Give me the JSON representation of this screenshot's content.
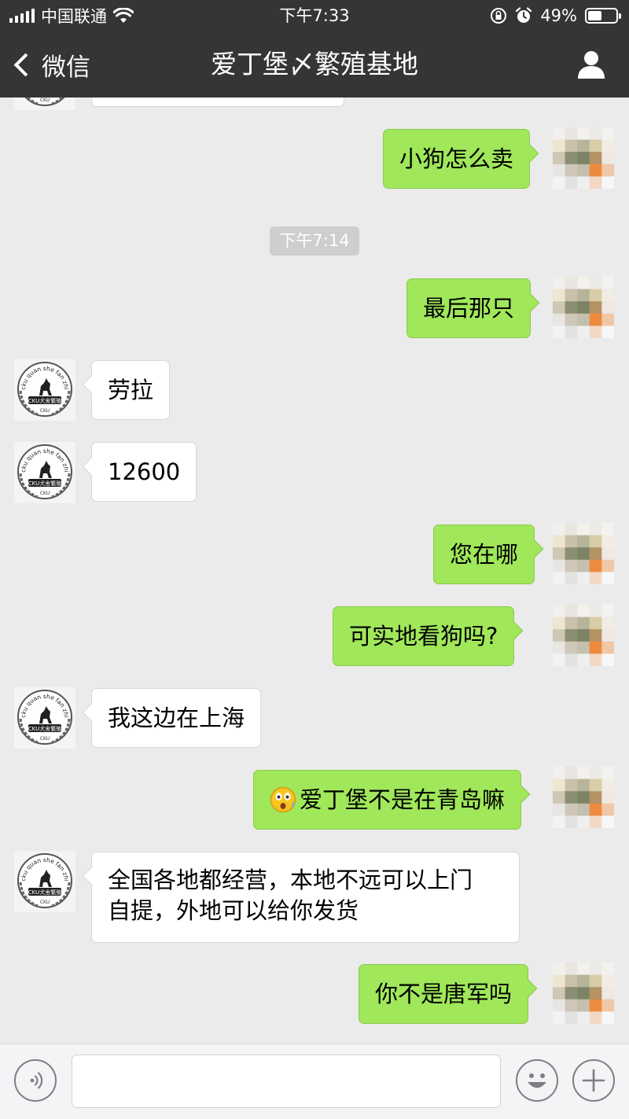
{
  "status_bar": {
    "carrier": "中国联通",
    "time": "下午7:33",
    "battery": "49%",
    "battery_level": 0.49
  },
  "nav": {
    "back_label": "微信",
    "title": "爱丁堡〆繁殖基地"
  },
  "chat": {
    "messages": [
      {
        "side": "in",
        "text": ""
      },
      {
        "side": "out",
        "text": "小狗怎么卖"
      },
      {
        "type": "timestamp",
        "text": "下午7:14"
      },
      {
        "side": "out",
        "text": "最后那只"
      },
      {
        "side": "in",
        "text": "劳拉"
      },
      {
        "side": "in",
        "text": "12600"
      },
      {
        "side": "out",
        "text": "您在哪"
      },
      {
        "side": "out",
        "text": "可实地看狗吗?"
      },
      {
        "side": "in",
        "text": "我这边在上海"
      },
      {
        "side": "out",
        "text": "爱丁堡不是在青岛嘛",
        "emoji": "surprised-emoji"
      },
      {
        "side": "in",
        "lines": [
          "全国各地都经营，本地不远可以上门",
          "自提，外地可以给你发货"
        ]
      },
      {
        "side": "out",
        "text": "你不是唐军吗"
      }
    ]
  },
  "avatar": {
    "badge_top_text": "cku quan she fan zhi",
    "badge_middle_text": "CKU犬舍繁殖",
    "badge_bottom_text": "CKU"
  },
  "input_bar": {
    "voice_icon": "voice-icon",
    "emoji_icon": "emoji-icon",
    "plus_icon": "plus-icon",
    "value": ""
  }
}
